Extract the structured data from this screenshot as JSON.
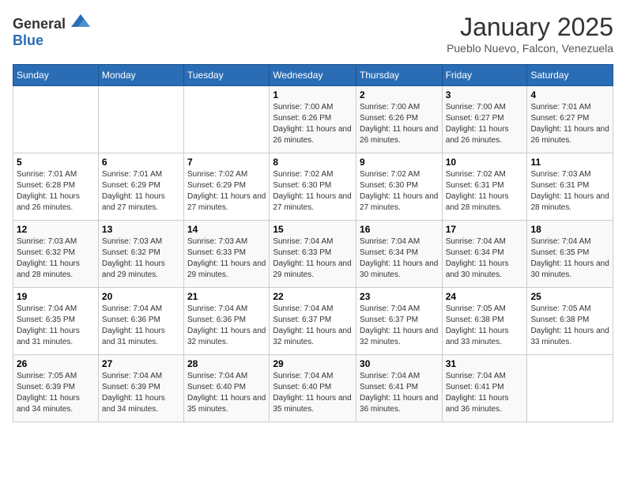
{
  "header": {
    "logo": {
      "general": "General",
      "blue": "Blue"
    },
    "title": "January 2025",
    "subtitle": "Pueblo Nuevo, Falcon, Venezuela"
  },
  "weekdays": [
    "Sunday",
    "Monday",
    "Tuesday",
    "Wednesday",
    "Thursday",
    "Friday",
    "Saturday"
  ],
  "weeks": [
    [
      {
        "day": "",
        "info": ""
      },
      {
        "day": "",
        "info": ""
      },
      {
        "day": "",
        "info": ""
      },
      {
        "day": "1",
        "info": "Sunrise: 7:00 AM\nSunset: 6:26 PM\nDaylight: 11 hours and 26 minutes."
      },
      {
        "day": "2",
        "info": "Sunrise: 7:00 AM\nSunset: 6:26 PM\nDaylight: 11 hours and 26 minutes."
      },
      {
        "day": "3",
        "info": "Sunrise: 7:00 AM\nSunset: 6:27 PM\nDaylight: 11 hours and 26 minutes."
      },
      {
        "day": "4",
        "info": "Sunrise: 7:01 AM\nSunset: 6:27 PM\nDaylight: 11 hours and 26 minutes."
      }
    ],
    [
      {
        "day": "5",
        "info": "Sunrise: 7:01 AM\nSunset: 6:28 PM\nDaylight: 11 hours and 26 minutes."
      },
      {
        "day": "6",
        "info": "Sunrise: 7:01 AM\nSunset: 6:29 PM\nDaylight: 11 hours and 27 minutes."
      },
      {
        "day": "7",
        "info": "Sunrise: 7:02 AM\nSunset: 6:29 PM\nDaylight: 11 hours and 27 minutes."
      },
      {
        "day": "8",
        "info": "Sunrise: 7:02 AM\nSunset: 6:30 PM\nDaylight: 11 hours and 27 minutes."
      },
      {
        "day": "9",
        "info": "Sunrise: 7:02 AM\nSunset: 6:30 PM\nDaylight: 11 hours and 27 minutes."
      },
      {
        "day": "10",
        "info": "Sunrise: 7:02 AM\nSunset: 6:31 PM\nDaylight: 11 hours and 28 minutes."
      },
      {
        "day": "11",
        "info": "Sunrise: 7:03 AM\nSunset: 6:31 PM\nDaylight: 11 hours and 28 minutes."
      }
    ],
    [
      {
        "day": "12",
        "info": "Sunrise: 7:03 AM\nSunset: 6:32 PM\nDaylight: 11 hours and 28 minutes."
      },
      {
        "day": "13",
        "info": "Sunrise: 7:03 AM\nSunset: 6:32 PM\nDaylight: 11 hours and 29 minutes."
      },
      {
        "day": "14",
        "info": "Sunrise: 7:03 AM\nSunset: 6:33 PM\nDaylight: 11 hours and 29 minutes."
      },
      {
        "day": "15",
        "info": "Sunrise: 7:04 AM\nSunset: 6:33 PM\nDaylight: 11 hours and 29 minutes."
      },
      {
        "day": "16",
        "info": "Sunrise: 7:04 AM\nSunset: 6:34 PM\nDaylight: 11 hours and 30 minutes."
      },
      {
        "day": "17",
        "info": "Sunrise: 7:04 AM\nSunset: 6:34 PM\nDaylight: 11 hours and 30 minutes."
      },
      {
        "day": "18",
        "info": "Sunrise: 7:04 AM\nSunset: 6:35 PM\nDaylight: 11 hours and 30 minutes."
      }
    ],
    [
      {
        "day": "19",
        "info": "Sunrise: 7:04 AM\nSunset: 6:35 PM\nDaylight: 11 hours and 31 minutes."
      },
      {
        "day": "20",
        "info": "Sunrise: 7:04 AM\nSunset: 6:36 PM\nDaylight: 11 hours and 31 minutes."
      },
      {
        "day": "21",
        "info": "Sunrise: 7:04 AM\nSunset: 6:36 PM\nDaylight: 11 hours and 32 minutes."
      },
      {
        "day": "22",
        "info": "Sunrise: 7:04 AM\nSunset: 6:37 PM\nDaylight: 11 hours and 32 minutes."
      },
      {
        "day": "23",
        "info": "Sunrise: 7:04 AM\nSunset: 6:37 PM\nDaylight: 11 hours and 32 minutes."
      },
      {
        "day": "24",
        "info": "Sunrise: 7:05 AM\nSunset: 6:38 PM\nDaylight: 11 hours and 33 minutes."
      },
      {
        "day": "25",
        "info": "Sunrise: 7:05 AM\nSunset: 6:38 PM\nDaylight: 11 hours and 33 minutes."
      }
    ],
    [
      {
        "day": "26",
        "info": "Sunrise: 7:05 AM\nSunset: 6:39 PM\nDaylight: 11 hours and 34 minutes."
      },
      {
        "day": "27",
        "info": "Sunrise: 7:04 AM\nSunset: 6:39 PM\nDaylight: 11 hours and 34 minutes."
      },
      {
        "day": "28",
        "info": "Sunrise: 7:04 AM\nSunset: 6:40 PM\nDaylight: 11 hours and 35 minutes."
      },
      {
        "day": "29",
        "info": "Sunrise: 7:04 AM\nSunset: 6:40 PM\nDaylight: 11 hours and 35 minutes."
      },
      {
        "day": "30",
        "info": "Sunrise: 7:04 AM\nSunset: 6:41 PM\nDaylight: 11 hours and 36 minutes."
      },
      {
        "day": "31",
        "info": "Sunrise: 7:04 AM\nSunset: 6:41 PM\nDaylight: 11 hours and 36 minutes."
      },
      {
        "day": "",
        "info": ""
      }
    ]
  ]
}
